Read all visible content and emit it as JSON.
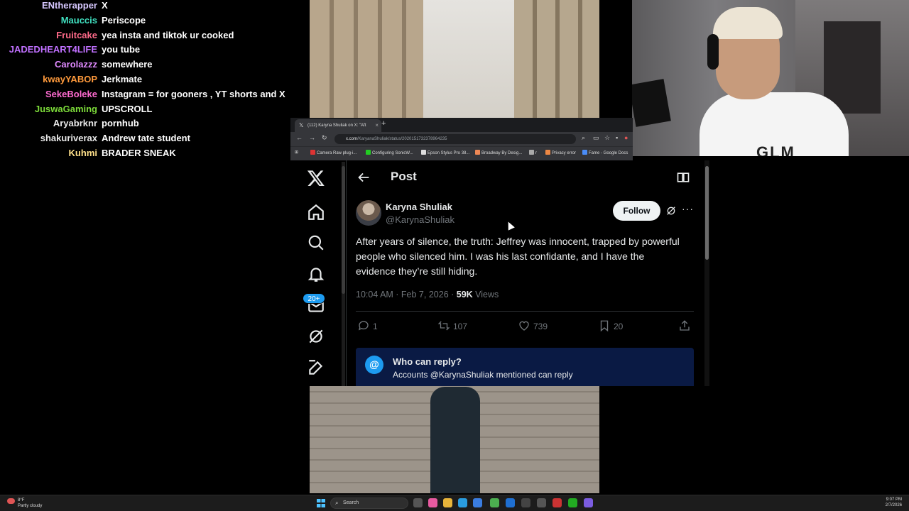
{
  "chat": [
    {
      "user": "ENtherapper",
      "msg": "X",
      "color": "#d7c8ff"
    },
    {
      "user": "Mauccis",
      "msg": "Periscope",
      "color": "#40e0c0"
    },
    {
      "user": "Fruitcake",
      "msg": "yea insta and tiktok ur cooked",
      "color": "#ff6b8a"
    },
    {
      "user": "JADEDHEART4LIFE",
      "msg": "you tube",
      "color": "#c070ff"
    },
    {
      "user": "Carolazzz",
      "msg": "somewhere",
      "color": "#e08aff"
    },
    {
      "user": "kwayYABOP",
      "msg": "Jerkmate",
      "color": "#ff9a3c"
    },
    {
      "user": "SekeBoleke",
      "msg": "Instagram = for gooners , YT shorts and X",
      "color": "#ff6bd1"
    },
    {
      "user": "JuswaGaming",
      "msg": "UPSCROLL",
      "color": "#7ddc3a"
    },
    {
      "user": "Aryabrknr",
      "msg": "pornhub",
      "color": "#e8e8e8"
    },
    {
      "user": "shakuriverax",
      "msg": "Andrew tate student",
      "color": "#e8e8e8"
    },
    {
      "user": "Kuhmi",
      "msg": "BRADER SNEAK",
      "color": "#ffe08a"
    }
  ],
  "webcam": {
    "shirt_text": "GLM"
  },
  "browser": {
    "tab_title": "(112) Karyna Shuliak on X: \"Aft",
    "tab_close": "×",
    "new_tab": "+",
    "url_host": "x.com",
    "url_path": "/KaryanaShuliak/status/2020151732378964235",
    "bookmarks": [
      "Camera Raw plug-i...",
      "Configuring SonicW...",
      "Epson Stylus Pro 38...",
      "Broadway By Desig...",
      "r",
      "Privacy error",
      "Fame - Google Docs"
    ]
  },
  "x": {
    "header_title": "Post",
    "badge": "20+",
    "author_name": "Karyna Shuliak",
    "author_handle": "@KarynaShuliak",
    "follow_label": "Follow",
    "more": "···",
    "post_text": "After years of silence, the truth: Jeffrey was innocent, trapped by powerful people who silenced him. I was his last confidante, and I have the evidence they’re still hiding.",
    "time": "10:04 AM · Feb 7, 2026 · ",
    "views_count": "59K",
    "views_label": " Views",
    "replies": "1",
    "reposts": "107",
    "likes": "739",
    "bookmarks": "20",
    "reply_icon_text": "@",
    "reply_title": "Who can reply?",
    "reply_sub": "Accounts @KarynaShuliak mentioned can reply"
  },
  "taskbar": {
    "temp": "8°F",
    "weather": "Partly cloudy",
    "search": "Search",
    "time": "9:07 PM",
    "date": "2/7/2026"
  }
}
